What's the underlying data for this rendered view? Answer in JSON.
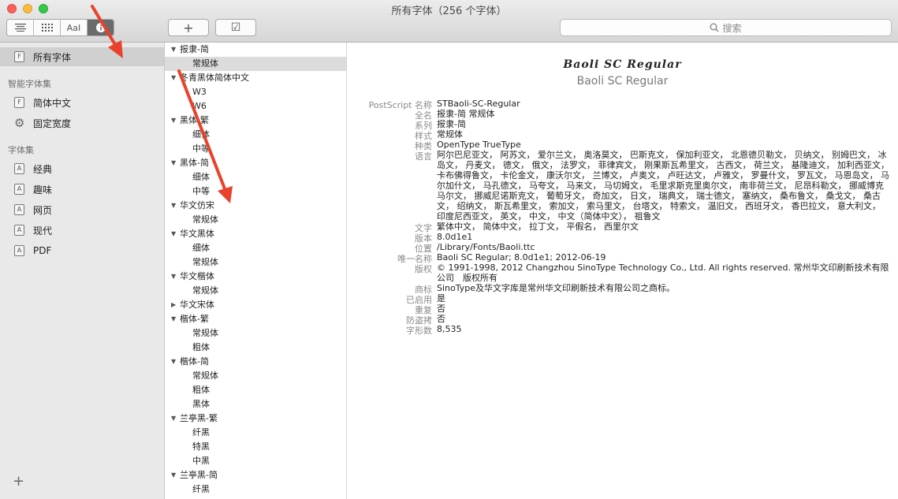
{
  "window": {
    "title": "所有字体（256 个字体）"
  },
  "toolbar": {
    "view_buttons": [
      "list-icon",
      "grid-icon",
      "sample-icon",
      "info-icon"
    ],
    "sample_label": "AaI",
    "add_label": "+",
    "check_label": "☑",
    "search_placeholder": "搜索"
  },
  "sidebar": {
    "all_fonts": "所有字体",
    "smart_header": "智能字体集",
    "smart_items": [
      "简体中文",
      "固定宽度"
    ],
    "collections_header": "字体集",
    "collections": [
      "经典",
      "趣味",
      "网页",
      "现代",
      "PDF"
    ],
    "add_label": "+"
  },
  "font_list": [
    {
      "type": "family",
      "label": "报隶-简",
      "open": true
    },
    {
      "type": "style",
      "label": "常规体",
      "selected": true
    },
    {
      "type": "family",
      "label": "冬青黑体简体中文",
      "open": true
    },
    {
      "type": "style",
      "label": "W3"
    },
    {
      "type": "style",
      "label": "W6"
    },
    {
      "type": "family",
      "label": "黑体-繁",
      "open": true
    },
    {
      "type": "style",
      "label": "细体"
    },
    {
      "type": "style",
      "label": "中等"
    },
    {
      "type": "family",
      "label": "黑体-简",
      "open": true
    },
    {
      "type": "style",
      "label": "细体"
    },
    {
      "type": "style",
      "label": "中等"
    },
    {
      "type": "family",
      "label": "华文仿宋",
      "open": true
    },
    {
      "type": "style",
      "label": "常规体"
    },
    {
      "type": "family",
      "label": "华文黑体",
      "open": true
    },
    {
      "type": "style",
      "label": "细体"
    },
    {
      "type": "style",
      "label": "常规体"
    },
    {
      "type": "family",
      "label": "华文楷体",
      "open": true
    },
    {
      "type": "style",
      "label": "常规体"
    },
    {
      "type": "family",
      "label": "华文宋体",
      "open": false
    },
    {
      "type": "family",
      "label": "楷体-繁",
      "open": true
    },
    {
      "type": "style",
      "label": "常规体"
    },
    {
      "type": "style",
      "label": "粗体"
    },
    {
      "type": "family",
      "label": "楷体-简",
      "open": true
    },
    {
      "type": "style",
      "label": "常规体"
    },
    {
      "type": "style",
      "label": "粗体"
    },
    {
      "type": "style",
      "label": "黑体"
    },
    {
      "type": "family",
      "label": "兰亭黑-繁",
      "open": true
    },
    {
      "type": "style",
      "label": "纤黑"
    },
    {
      "type": "style",
      "label": "特黑"
    },
    {
      "type": "style",
      "label": "中黑"
    },
    {
      "type": "family",
      "label": "兰亭黑-简",
      "open": true
    },
    {
      "type": "style",
      "label": "纤黑"
    }
  ],
  "detail": {
    "display_name": "Baoli SC Regular",
    "subtitle": "Baoli SC Regular",
    "fields": [
      {
        "key": "PostScript 名称",
        "value": "STBaoli-SC-Regular",
        "lines": 1
      },
      {
        "key": "全名",
        "value": "报隶-简 常规体",
        "lines": 1
      },
      {
        "key": "系列",
        "value": "报隶-简",
        "lines": 1
      },
      {
        "key": "样式",
        "value": "常规体",
        "lines": 1
      },
      {
        "key": "种类",
        "value": "OpenType TrueType",
        "lines": 1
      },
      {
        "key": "语言",
        "value": "阿尔巴尼亚文， 阿苏文， 爱尔兰文， 奥洛莫文， 巴斯克文， 保加利亚文， 北恩德贝勒文， 贝纳文， 别姆巴文， 冰岛文， 丹麦文， 德文， 俄文， 法罗文， 菲律宾文， 刚果斯瓦希里文， 古西文， 荷兰文， 基隆迪文， 加利西亚文， 卡布佛得鲁文， 卡伦金文， 康沃尔文， 兰博文， 卢奥文， 卢旺达文， 卢雅文， 罗曼什文， 罗瓦文， 马恩岛文， 马尔加什文， 马孔德文， 马夸文， 马来文， 马切姆文， 毛里求斯克里奥尔文， 南非荷兰文， 尼昂科勒文， 挪威博克马尔文， 挪威尼诺斯克文， 葡萄牙文， 奇加文， 日文， 瑞典文， 瑞士德文， 塞纳文， 桑布鲁文， 桑戈文， 桑古文， 绍纳文， 斯瓦希里文， 索加文， 索马里文， 台塔文， 特索文， 温旧文， 西班牙文， 香巴拉文， 意大利文， 印度尼西亚文， 英文， 中文， 中文（简体中文）， 祖鲁文",
        "lines": 7
      },
      {
        "key": "文字",
        "value": "繁体中文， 简体中文， 拉丁文， 平假名， 西里尔文",
        "lines": 1
      },
      {
        "key": "版本",
        "value": "8.0d1e1",
        "lines": 1
      },
      {
        "key": "位置",
        "value": "/Library/Fonts/Baoli.ttc",
        "lines": 1
      },
      {
        "key": "唯一名称",
        "value": "Baoli SC Regular; 8.0d1e1; 2012-06-19",
        "lines": 1
      },
      {
        "key": "版权",
        "value": "© 1991-1998, 2012 Changzhou SinoType Technology Co., Ltd.  All rights reserved. 常州华文印刷新技术有限公司　版权所有",
        "lines": 2
      },
      {
        "key": "商标",
        "value": "SinoType及华文字库是常州华文印刷新技术有限公司之商标。",
        "lines": 1
      },
      {
        "key": "已启用",
        "value": "是",
        "lines": 1
      },
      {
        "key": "重复",
        "value": "否",
        "lines": 1
      },
      {
        "key": "防盗拷",
        "value": "否",
        "lines": 1
      },
      {
        "key": "字形数",
        "value": "8,535",
        "lines": 1
      }
    ]
  },
  "colors": {
    "arrow": "#e8412c",
    "sidebar_bg": "#e9e9e9",
    "selection": "#d0d0d0"
  }
}
